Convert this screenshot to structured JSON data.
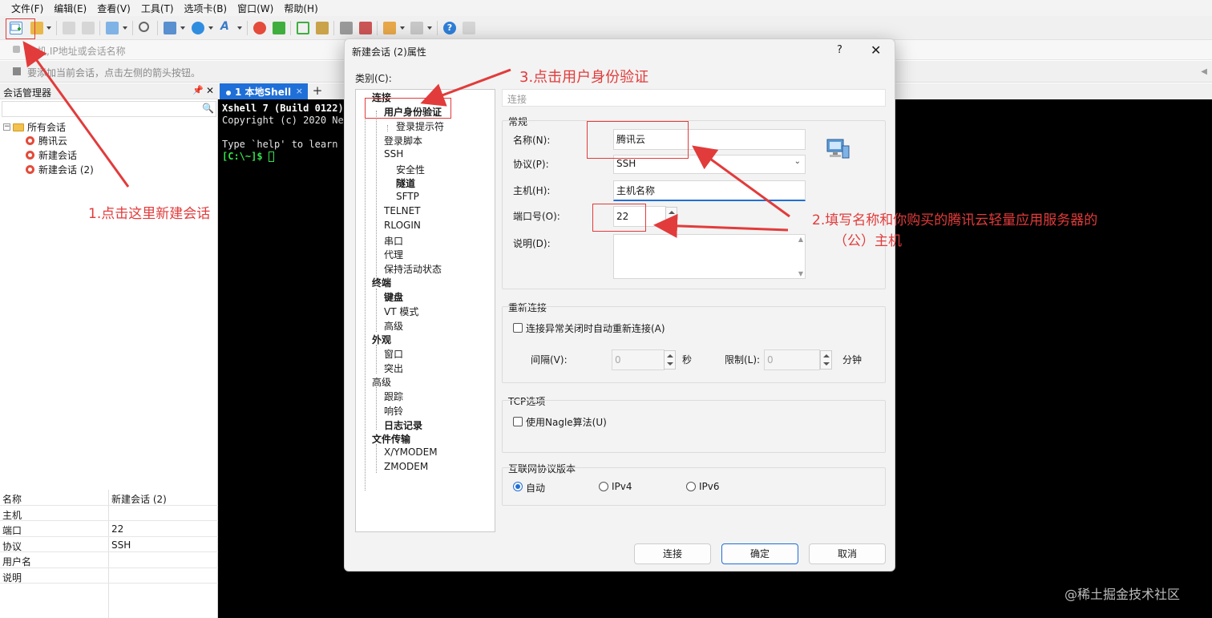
{
  "menu": [
    "文件(F)",
    "编辑(E)",
    "查看(V)",
    "工具(T)",
    "选项卡(B)",
    "窗口(W)",
    "帮助(H)"
  ],
  "address_placeholder": "主机,IP地址或会话名称",
  "hint_text": "要添加当前会话，点击左侧的箭头按钮。",
  "session_manager": {
    "title": "会话管理器",
    "pin": "⬛",
    "close": "✕",
    "tree": {
      "root": "所有会话",
      "items": [
        "腾讯云",
        "新建会话",
        "新建会话 (2)"
      ]
    },
    "properties": [
      {
        "key": "名称",
        "value": "新建会话 (2)"
      },
      {
        "key": "主机",
        "value": ""
      },
      {
        "key": "端口",
        "value": "22"
      },
      {
        "key": "协议",
        "value": "SSH"
      },
      {
        "key": "用户名",
        "value": ""
      },
      {
        "key": "说明",
        "value": ""
      }
    ]
  },
  "terminal": {
    "tab_label": "1 本地Shell",
    "tab_close": "×",
    "plus": "+",
    "lines": [
      "Xshell 7 (Build 0122)",
      "Copyright (c) 2020 Ne",
      "",
      "Type `help' to learn"
    ],
    "prompt": "[C:\\~]$ "
  },
  "dialog": {
    "title": "新建会话 (2)属性",
    "help": "?",
    "close": "✕",
    "category_label": "类别(C):",
    "categories": [
      {
        "label": "连接",
        "bold": true
      },
      {
        "label": "用户身份验证",
        "bold": true
      },
      {
        "label": "登录提示符",
        "bold": false
      },
      {
        "label": "登录脚本",
        "bold": false
      },
      {
        "label": "SSH",
        "bold": false
      },
      {
        "label": "安全性",
        "bold": false
      },
      {
        "label": "隧道",
        "bold": true
      },
      {
        "label": "SFTP",
        "bold": false
      },
      {
        "label": "TELNET",
        "bold": false
      },
      {
        "label": "RLOGIN",
        "bold": false
      },
      {
        "label": "串口",
        "bold": false
      },
      {
        "label": "代理",
        "bold": false
      },
      {
        "label": "保持活动状态",
        "bold": false
      },
      {
        "label": "终端",
        "bold": true
      },
      {
        "label": "键盘",
        "bold": true
      },
      {
        "label": "VT 模式",
        "bold": false
      },
      {
        "label": "高级",
        "bold": false
      },
      {
        "label": "外观",
        "bold": true
      },
      {
        "label": "窗口",
        "bold": false
      },
      {
        "label": "突出",
        "bold": false
      },
      {
        "label": "高级",
        "bold": false
      },
      {
        "label": "跟踪",
        "bold": false
      },
      {
        "label": "响铃",
        "bold": false
      },
      {
        "label": "日志记录",
        "bold": true
      },
      {
        "label": "文件传输",
        "bold": true
      },
      {
        "label": "X/YMODEM",
        "bold": false
      },
      {
        "label": "ZMODEM",
        "bold": false
      }
    ],
    "section_header": "连接",
    "general": {
      "title": "常规",
      "name_label": "名称(N):",
      "name_value": "腾讯云",
      "protocol_label": "协议(P):",
      "protocol_value": "SSH",
      "host_label": "主机(H):",
      "host_value": "主机名称",
      "port_label": "端口号(O):",
      "port_value": "22",
      "desc_label": "说明(D):",
      "desc_value": ""
    },
    "reconnect": {
      "title": "重新连接",
      "auto_label": "连接异常关闭时自动重新连接(A)",
      "interval_label": "间隔(V):",
      "interval_value": "0",
      "interval_unit": "秒",
      "limit_label": "限制(L):",
      "limit_value": "0",
      "limit_unit": "分钟"
    },
    "tcp": {
      "title": "TCP选项",
      "nagle_label": "使用Nagle算法(U)"
    },
    "ipver": {
      "title": "互联网协议版本",
      "options": [
        "自动",
        "IPv4",
        "IPv6"
      ],
      "selected": "自动"
    },
    "buttons": {
      "connect": "连接",
      "ok": "确定",
      "cancel": "取消"
    }
  },
  "annotations": {
    "step1": "1.点击这里新建会话",
    "step2_line1": "2.填写名称和你购买的腾讯云轻量应用服务器的",
    "step2_line2": "（公）主机",
    "step3": "3.点击用户身份验证",
    "color": "#e23b3b"
  },
  "watermark": "@稀土掘金技术社区",
  "colors": {
    "accent": "#1f6fd8",
    "terminal_green": "#33e24a",
    "annotation": "#e23b3b"
  }
}
